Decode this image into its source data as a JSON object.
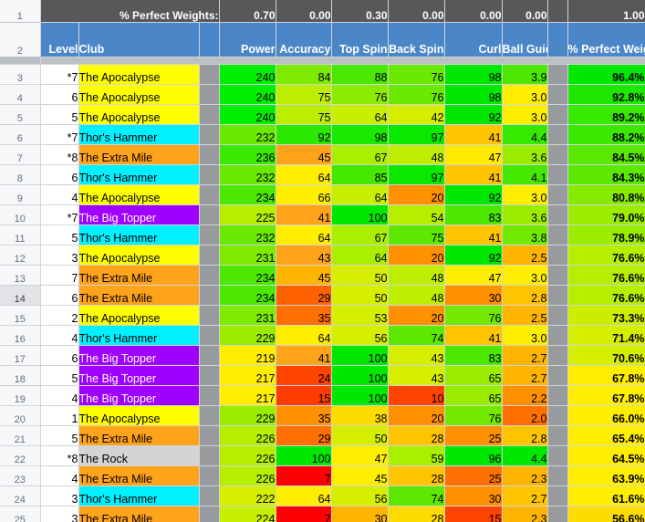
{
  "sheet": {
    "weights_label": "% Perfect Weights:",
    "weights": [
      "0.70",
      "0.00",
      "0.30",
      "0.00",
      "0.00",
      "0.00",
      "1.00"
    ],
    "columns": [
      {
        "key": "level",
        "label": "Level",
        "align": "right"
      },
      {
        "key": "club",
        "label": "Club",
        "align": "left"
      },
      {
        "key": "gap1",
        "label": "",
        "align": "right"
      },
      {
        "key": "power",
        "label": "Power",
        "align": "right"
      },
      {
        "key": "accuracy",
        "label": "Accuracy",
        "align": "right"
      },
      {
        "key": "topspin",
        "label": "Top Spin",
        "align": "right"
      },
      {
        "key": "backspin",
        "label": "Back Spin",
        "align": "right"
      },
      {
        "key": "curl",
        "label": "Curl",
        "align": "right"
      },
      {
        "key": "ballguide",
        "label": "Ball Guide",
        "align": "right"
      },
      {
        "key": "gap2",
        "label": "",
        "align": "right"
      },
      {
        "key": "pctweighted",
        "label": "% Perfect Weighted↓",
        "align": "right"
      }
    ],
    "header_row_numbers": [
      "1",
      "2"
    ],
    "selected_row": "14",
    "club_colors": {
      "The Apocalypse": {
        "bg": "#ffff00",
        "fg": "#000000"
      },
      "Thor's Hammer": {
        "bg": "#00f0ff",
        "fg": "#000000"
      },
      "The Extra Mile": {
        "bg": "#ffa31a",
        "fg": "#000000"
      },
      "The Big Topper": {
        "bg": "#a000ff",
        "fg": "#ffffff"
      },
      "The Rock": {
        "bg": "#d4d4d4",
        "fg": "#000000"
      }
    },
    "rows": [
      {
        "n": "3",
        "level": "*7",
        "club": "The Apocalypse",
        "power": "240",
        "accuracy": "84",
        "topspin": "88",
        "backspin": "76",
        "curl": "98",
        "ballguide": "3.9",
        "pct": "96.4%",
        "c": {
          "power": "#00ee00",
          "accuracy": "#7dea00",
          "topspin": "#4ae800",
          "backspin": "#6ce900",
          "curl": "#00e800",
          "ballguide": "#4ce800",
          "pct": "#00e800"
        }
      },
      {
        "n": "4",
        "level": "6",
        "club": "The Apocalypse",
        "power": "240",
        "accuracy": "75",
        "topspin": "76",
        "backspin": "76",
        "curl": "98",
        "ballguide": "3.0",
        "pct": "92.8%",
        "c": {
          "power": "#00ee00",
          "accuracy": "#bbee00",
          "topspin": "#8aea00",
          "backspin": "#6ce900",
          "curl": "#00e800",
          "ballguide": "#ffee00",
          "pct": "#1ee800"
        }
      },
      {
        "n": "5",
        "level": "5",
        "club": "The Apocalypse",
        "power": "240",
        "accuracy": "75",
        "topspin": "64",
        "backspin": "42",
        "curl": "92",
        "ballguide": "3.0",
        "pct": "89.2%",
        "c": {
          "power": "#00ee00",
          "accuracy": "#bbee00",
          "topspin": "#c8ee00",
          "backspin": "#d6ee00",
          "curl": "#00e800",
          "ballguide": "#ffee00",
          "pct": "#37e800"
        }
      },
      {
        "n": "6",
        "level": "*7",
        "club": "Thor's Hammer",
        "power": "232",
        "accuracy": "92",
        "topspin": "98",
        "backspin": "97",
        "curl": "41",
        "ballguide": "4.4",
        "pct": "88.2%",
        "c": {
          "power": "#6ce900",
          "accuracy": "#2ae800",
          "topspin": "#1ae800",
          "backspin": "#0ae800",
          "curl": "#ffc400",
          "ballguide": "#37e800",
          "pct": "#3ce800"
        }
      },
      {
        "n": "7",
        "level": "*8",
        "club": "The Extra Mile",
        "power": "236",
        "accuracy": "45",
        "topspin": "67",
        "backspin": "48",
        "curl": "47",
        "ballguide": "3.6",
        "pct": "84.5%",
        "c": {
          "power": "#3ae800",
          "accuracy": "#ffa31a",
          "topspin": "#aaee00",
          "backspin": "#c0ee00",
          "curl": "#ffea00",
          "ballguide": "#9cec00",
          "pct": "#5ae800"
        }
      },
      {
        "n": "8",
        "level": "6",
        "club": "Thor's Hammer",
        "power": "232",
        "accuracy": "64",
        "topspin": "85",
        "backspin": "97",
        "curl": "41",
        "ballguide": "4.1",
        "pct": "84.3%",
        "c": {
          "power": "#6ce900",
          "accuracy": "#ffee00",
          "topspin": "#44e800",
          "backspin": "#0ae800",
          "curl": "#ffc400",
          "ballguide": "#46e800",
          "pct": "#5ce800"
        }
      },
      {
        "n": "9",
        "level": "4",
        "club": "The Apocalypse",
        "power": "234",
        "accuracy": "66",
        "topspin": "64",
        "backspin": "20",
        "curl": "92",
        "ballguide": "3.0",
        "pct": "80.8%",
        "c": {
          "power": "#4ce800",
          "accuracy": "#ffee00",
          "topspin": "#c8ee00",
          "backspin": "#ff9000",
          "curl": "#00e800",
          "ballguide": "#ffee00",
          "pct": "#86ea00"
        }
      },
      {
        "n": "10",
        "level": "*7",
        "club": "The Big Topper",
        "power": "225",
        "accuracy": "41",
        "topspin": "100",
        "backspin": "54",
        "curl": "83",
        "ballguide": "3.6",
        "pct": "79.0%",
        "c": {
          "power": "#b6ee00",
          "accuracy": "#ffa31a",
          "topspin": "#00e800",
          "backspin": "#b6ee00",
          "curl": "#4ce800",
          "ballguide": "#9cec00",
          "pct": "#9aec00"
        }
      },
      {
        "n": "11",
        "level": "5",
        "club": "Thor's Hammer",
        "power": "232",
        "accuracy": "64",
        "topspin": "67",
        "backspin": "75",
        "curl": "41",
        "ballguide": "3.8",
        "pct": "78.9%",
        "c": {
          "power": "#6ce900",
          "accuracy": "#ffee00",
          "topspin": "#aaee00",
          "backspin": "#5ce800",
          "curl": "#ffc400",
          "ballguide": "#72e900",
          "pct": "#9aec00"
        }
      },
      {
        "n": "12",
        "level": "3",
        "club": "The Apocalypse",
        "power": "231",
        "accuracy": "43",
        "topspin": "64",
        "backspin": "20",
        "curl": "92",
        "ballguide": "2.5",
        "pct": "76.6%",
        "c": {
          "power": "#7eea00",
          "accuracy": "#ffa31a",
          "topspin": "#aaee00",
          "backspin": "#ff9000",
          "curl": "#00e800",
          "ballguide": "#ffb400",
          "pct": "#b6ee00"
        }
      },
      {
        "n": "13",
        "level": "7",
        "club": "The Extra Mile",
        "power": "234",
        "accuracy": "45",
        "topspin": "50",
        "backspin": "48",
        "curl": "47",
        "ballguide": "3.0",
        "pct": "76.6%",
        "c": {
          "power": "#4ce800",
          "accuracy": "#ffb400",
          "topspin": "#d6ee00",
          "backspin": "#c0ee00",
          "curl": "#ffee00",
          "ballguide": "#ffee00",
          "pct": "#b6ee00"
        }
      },
      {
        "n": "14",
        "level": "6",
        "club": "The Extra Mile",
        "power": "234",
        "accuracy": "29",
        "topspin": "50",
        "backspin": "48",
        "curl": "30",
        "ballguide": "2.8",
        "pct": "76.6%",
        "c": {
          "power": "#4ce800",
          "accuracy": "#ff6000",
          "topspin": "#d6ee00",
          "backspin": "#c0ee00",
          "curl": "#ff9000",
          "ballguide": "#ffc400",
          "pct": "#b6ee00"
        }
      },
      {
        "n": "15",
        "level": "2",
        "club": "The Apocalypse",
        "power": "231",
        "accuracy": "35",
        "topspin": "53",
        "backspin": "20",
        "curl": "76",
        "ballguide": "2.5",
        "pct": "73.3%",
        "c": {
          "power": "#7eea00",
          "accuracy": "#ff7000",
          "topspin": "#d6ee00",
          "backspin": "#ff9000",
          "curl": "#74e900",
          "ballguide": "#ffb400",
          "pct": "#cbee00"
        }
      },
      {
        "n": "16",
        "level": "4",
        "club": "Thor's Hammer",
        "power": "229",
        "accuracy": "64",
        "topspin": "56",
        "backspin": "74",
        "curl": "41",
        "ballguide": "3.0",
        "pct": "71.4%",
        "c": {
          "power": "#9aec00",
          "accuracy": "#ffee00",
          "topspin": "#d6ee00",
          "backspin": "#5ce800",
          "curl": "#ffc400",
          "ballguide": "#ffee00",
          "pct": "#d6ee00"
        }
      },
      {
        "n": "17",
        "level": "6",
        "club": "The Big Topper",
        "power": "219",
        "accuracy": "41",
        "topspin": "100",
        "backspin": "43",
        "curl": "83",
        "ballguide": "2.7",
        "pct": "70.6%",
        "c": {
          "power": "#ffee00",
          "accuracy": "#ffa31a",
          "topspin": "#00e800",
          "backspin": "#d6ee00",
          "curl": "#4ce800",
          "ballguide": "#ffb400",
          "pct": "#d6ee00"
        }
      },
      {
        "n": "18",
        "level": "5",
        "club": "The Big Topper",
        "power": "217",
        "accuracy": "24",
        "topspin": "100",
        "backspin": "43",
        "curl": "65",
        "ballguide": "2.7",
        "pct": "67.8%",
        "c": {
          "power": "#ffee00",
          "accuracy": "#ff4400",
          "topspin": "#00e800",
          "backspin": "#d6ee00",
          "curl": "#9aec00",
          "ballguide": "#ffb400",
          "pct": "#ffee00"
        }
      },
      {
        "n": "19",
        "level": "4",
        "club": "The Big Topper",
        "power": "217",
        "accuracy": "15",
        "topspin": "100",
        "backspin": "10",
        "curl": "65",
        "ballguide": "2.2",
        "pct": "67.8%",
        "c": {
          "power": "#ffee00",
          "accuracy": "#ff3c00",
          "topspin": "#00e800",
          "backspin": "#ff4400",
          "curl": "#9aec00",
          "ballguide": "#ff9000",
          "pct": "#ffee00"
        }
      },
      {
        "n": "20",
        "level": "1",
        "club": "The Apocalypse",
        "power": "229",
        "accuracy": "35",
        "topspin": "38",
        "backspin": "20",
        "curl": "76",
        "ballguide": "2.0",
        "pct": "66.0%",
        "c": {
          "power": "#9aec00",
          "accuracy": "#ff9000",
          "topspin": "#ffdc00",
          "backspin": "#ff9000",
          "curl": "#74e900",
          "ballguide": "#ff7000",
          "pct": "#ffee00"
        }
      },
      {
        "n": "21",
        "level": "5",
        "club": "The Extra Mile",
        "power": "226",
        "accuracy": "29",
        "topspin": "50",
        "backspin": "28",
        "curl": "25",
        "ballguide": "2.8",
        "pct": "65.4%",
        "c": {
          "power": "#b6ee00",
          "accuracy": "#ff7000",
          "topspin": "#d6ee00",
          "backspin": "#ffc400",
          "curl": "#ff9000",
          "ballguide": "#ffc400",
          "pct": "#ffee00"
        }
      },
      {
        "n": "22",
        "level": "*8",
        "club": "The Rock",
        "power": "226",
        "accuracy": "100",
        "topspin": "47",
        "backspin": "59",
        "curl": "96",
        "ballguide": "4.4",
        "pct": "64.5%",
        "c": {
          "power": "#b6ee00",
          "accuracy": "#00e800",
          "topspin": "#ffee00",
          "backspin": "#aaee00",
          "curl": "#00e800",
          "ballguide": "#00e800",
          "pct": "#ffee00"
        }
      },
      {
        "n": "23",
        "level": "4",
        "club": "The Extra Mile",
        "power": "226",
        "accuracy": "7",
        "topspin": "45",
        "backspin": "28",
        "curl": "25",
        "ballguide": "2.3",
        "pct": "63.9%",
        "c": {
          "power": "#b6ee00",
          "accuracy": "#ff0000",
          "topspin": "#ffee00",
          "backspin": "#ffc400",
          "curl": "#ff7000",
          "ballguide": "#ffb400",
          "pct": "#ffee00"
        }
      },
      {
        "n": "24",
        "level": "3",
        "club": "Thor's Hammer",
        "power": "222",
        "accuracy": "64",
        "topspin": "56",
        "backspin": "74",
        "curl": "30",
        "ballguide": "2.7",
        "pct": "61.6%",
        "c": {
          "power": "#d6ee00",
          "accuracy": "#ffee00",
          "topspin": "#d6ee00",
          "backspin": "#5ce800",
          "curl": "#ff9000",
          "ballguide": "#ffc400",
          "pct": "#ffee00"
        }
      },
      {
        "n": "25",
        "level": "3",
        "club": "The Extra Mile",
        "power": "224",
        "accuracy": "7",
        "topspin": "30",
        "backspin": "28",
        "curl": "15",
        "ballguide": "2.3",
        "pct": "56.6%",
        "c": {
          "power": "#c8ee00",
          "accuracy": "#ff0000",
          "topspin": "#ffb400",
          "backspin": "#ffdc00",
          "curl": "#ff4400",
          "ballguide": "#ffb400",
          "pct": "#ffdc00"
        }
      }
    ]
  }
}
